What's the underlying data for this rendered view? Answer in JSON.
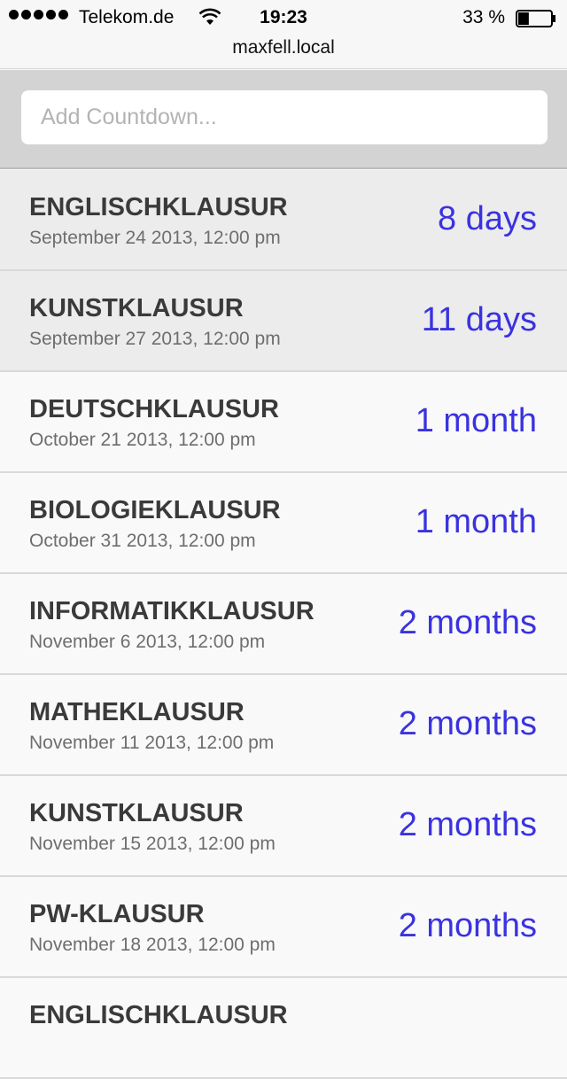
{
  "status_bar": {
    "carrier": "Telekom.de",
    "time": "19:23",
    "battery": "33 %",
    "battery_level": 0.33
  },
  "url_bar": {
    "host": "maxfell.local"
  },
  "add_countdown": {
    "placeholder": "Add Countdown...",
    "value": ""
  },
  "countdowns": [
    {
      "title": "ENGLISCHKLAUSUR",
      "date": "September 24 2013, 12:00 pm",
      "remaining": "8 days"
    },
    {
      "title": "KUNSTKLAUSUR",
      "date": "September 27 2013, 12:00 pm",
      "remaining": "11 days"
    },
    {
      "title": "DEUTSCHKLAUSUR",
      "date": "October 21 2013, 12:00 pm",
      "remaining": "1 month"
    },
    {
      "title": "BIOLOGIEKLAUSUR",
      "date": "October 31 2013, 12:00 pm",
      "remaining": "1 month"
    },
    {
      "title": "INFORMATIKKLAUSUR",
      "date": "November 6 2013, 12:00 pm",
      "remaining": "2 months"
    },
    {
      "title": "MATHEKLAUSUR",
      "date": "November 11 2013, 12:00 pm",
      "remaining": "2 months"
    },
    {
      "title": "KUNSTKLAUSUR",
      "date": "November 15 2013, 12:00 pm",
      "remaining": "2 months"
    },
    {
      "title": "PW-KLAUSUR",
      "date": "November 18 2013, 12:00 pm",
      "remaining": "2 months"
    },
    {
      "title": "ENGLISCHKLAUSUR",
      "date": "",
      "remaining": ""
    }
  ],
  "colors": {
    "accent": "#3a32e0",
    "highlight_row": "#ececec",
    "row_background": "#f9f9f9",
    "panel_background": "#d3d3d3"
  }
}
